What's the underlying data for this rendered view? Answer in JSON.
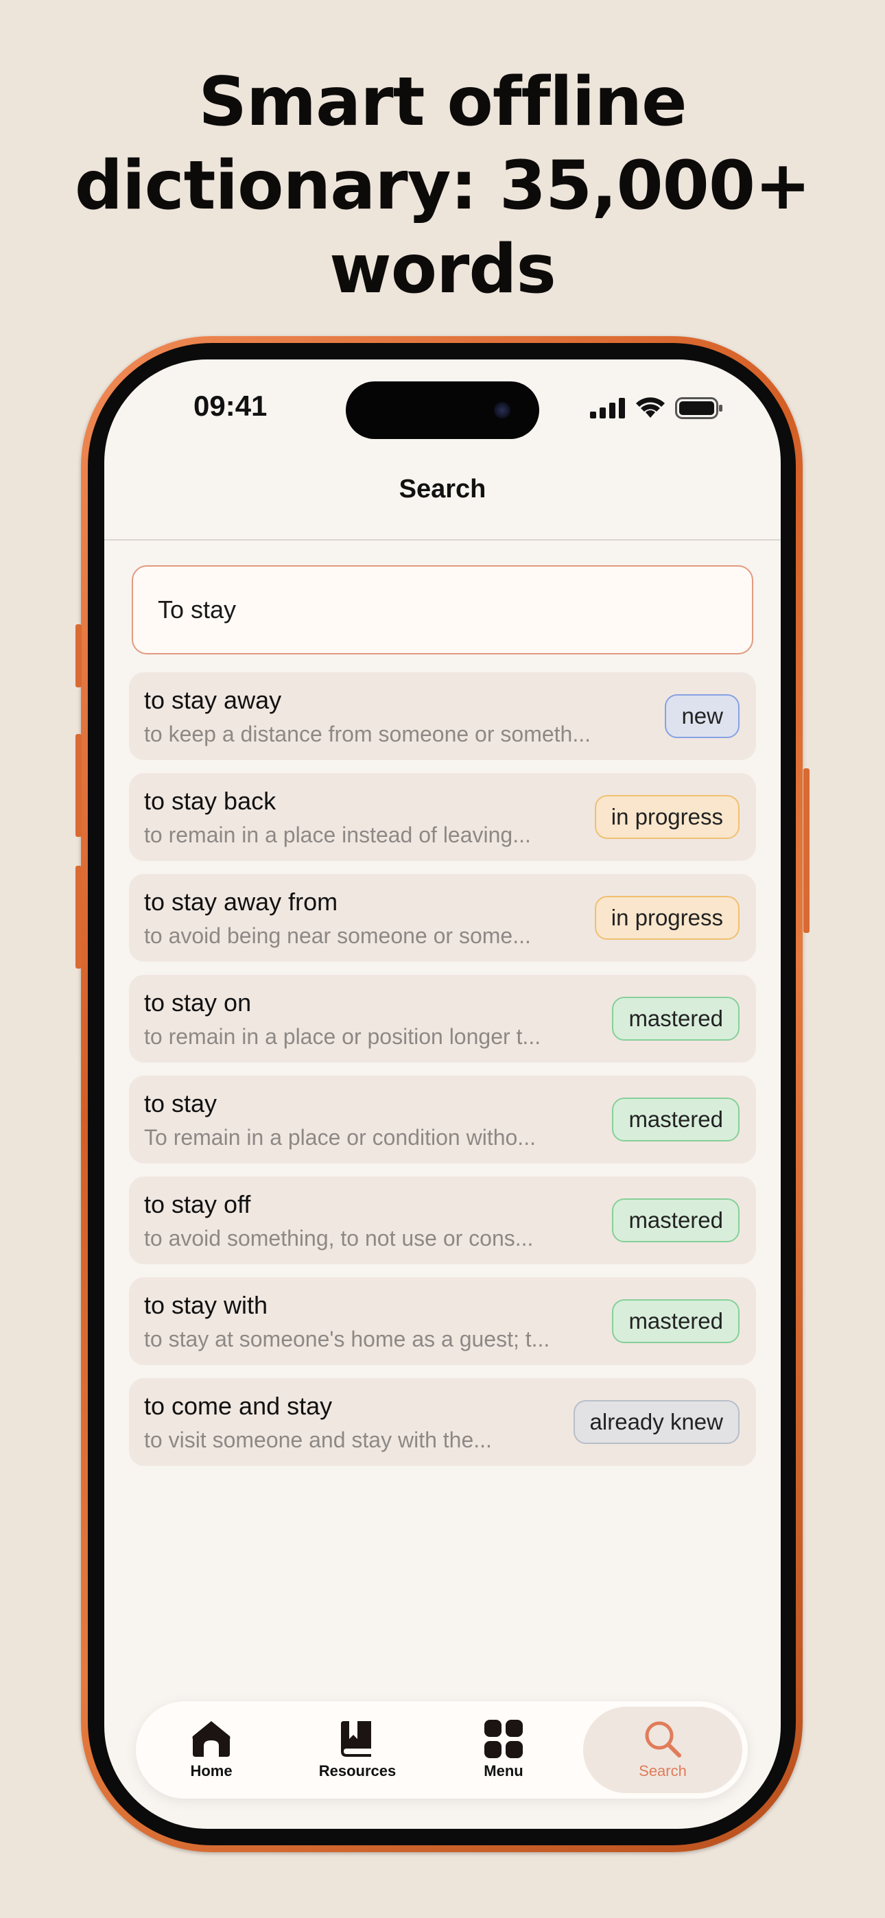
{
  "headline": "Smart offline\ndictionary: 35,000+\nwords",
  "status_bar": {
    "time": "09:41"
  },
  "nav": {
    "title": "Search"
  },
  "search": {
    "value": "To stay"
  },
  "results": [
    {
      "word": "to stay away",
      "definition": "to keep a distance from someone or someth...",
      "status": "new"
    },
    {
      "word": "to stay back",
      "definition": "to remain in a place instead of leaving...",
      "status": "in progress"
    },
    {
      "word": "to stay away from",
      "definition": "to avoid being near someone or some...",
      "status": "in progress"
    },
    {
      "word": "to stay on",
      "definition": "to remain in a place or position longer t...",
      "status": "mastered"
    },
    {
      "word": "to stay",
      "definition": "To remain in a place or condition witho...",
      "status": "mastered"
    },
    {
      "word": "to stay off",
      "definition": "to avoid something, to not use or cons...",
      "status": "mastered"
    },
    {
      "word": "to stay with",
      "definition": "to stay at someone's home as a guest; t...",
      "status": "mastered"
    },
    {
      "word": "to come and stay",
      "definition": "to visit someone and stay with the...",
      "status": "already knew"
    }
  ],
  "tabs": [
    {
      "label": "Home",
      "icon": "house-icon"
    },
    {
      "label": "Resources",
      "icon": "book-icon"
    },
    {
      "label": "Menu",
      "icon": "grid-icon"
    },
    {
      "label": "Search",
      "icon": "search-icon",
      "active": true
    }
  ],
  "colors": {
    "background": "#ede4da",
    "phone_frame": "#d86a32",
    "accent": "#e07c5a",
    "badge_new": "#86a2e2",
    "badge_progress": "#f0c070",
    "badge_mastered": "#86d098",
    "badge_knew": "#b7bec8"
  }
}
